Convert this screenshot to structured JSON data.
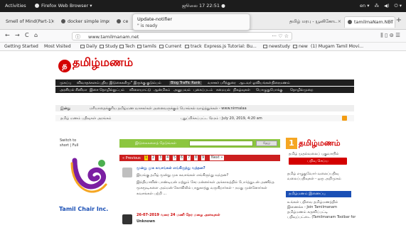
{
  "topbar": {
    "activities": "Activities",
    "app": "Firefox Web Browser ▾",
    "clock": "ஜூலை 17 22:51 ●",
    "lang": "en ▾",
    "net": "⁂",
    "sound": "◀)",
    "power": "⏻ ▾"
  },
  "notification": {
    "title": "Update-notifier",
    "body": "\" is ready"
  },
  "tabs": [
    {
      "label": "Smell of Mind(Part-1)"
    },
    {
      "label": "docker simple imp"
    },
    {
      "label": "ce"
    },
    {
      "label": "தமிழ் மரபு - யூனிகோட"
    },
    {
      "label": "tamilmaNam.NET"
    }
  ],
  "tab_close": "×",
  "tab_new": "+",
  "nav": {
    "back": "←",
    "forward": "→",
    "reload": "C",
    "home": "⌂",
    "url": "www.tamilmanam.net",
    "url_actions": "··· ♡ ☆",
    "tools": "⫼ ▯ ⊚ ☰"
  },
  "bookmarks": [
    "Getting Started",
    "Most Visited",
    "Daily",
    "Study",
    "Tech",
    "tamils",
    "Current",
    "track",
    "Express.js Tutorial: Bu...",
    "newstudy",
    "new",
    "(1) Mugam Tamil Movi..."
  ],
  "site": {
    "logo": "தமிழ்மணம்",
    "menu1": [
      "முகப்பு",
      "விவாதக்களம்",
      "புதிய இடுகைகள்",
      "\"மு\" இருக்கு",
      "குடும்பம்",
      "Blog Traffic Rank",
      "வாசகர் பரிந்துரை",
      "ஆடவர் ஓவியங்கள்",
      "திரைமணம்"
    ],
    "menu2": [
      "அரசியல்",
      "சினிமா",
      "இசை",
      "தொழில்நுட்பம்",
      "விளையாட்டு",
      "ஆன்மிகம்",
      "அனுபவம்",
      "புகைப்படம்",
      "சமையல்",
      "நிகழ்வுகள்",
      "பொழுதுபோக்கு",
      "தொழில்முறை"
    ],
    "ticker_label": "இன்று",
    "ticker_text": "மரியாதைக்குரிய தமிழ்மண வாசகர்கள் அனைவருக்கும் பொங்கல் வாழ்த்துக்கள் - www.nirmalaa",
    "ticker2_left": "தமிழ் மணம் பதிவுகள் அரங்கம்",
    "ticker2_right": "புதுப்பிக்கப்பட்ட நேரம் : July 20, 2019, 4:20 am",
    "switch": "Switch to\nshort | Full",
    "tamil_chair": "Tamil Chair Inc.",
    "search_label": "இடுகைகளைத் தேடுங்கள்",
    "search_button": "தேடு",
    "pager_prev": "« Previous",
    "pager_pages": [
      "1",
      "2",
      "3",
      "4",
      "5",
      "6",
      "7",
      "8",
      "9"
    ],
    "pager_next": "Next »",
    "posts": [
      {
        "title": "மூன்று முக கவசங்கள் எங்கிருந்து வந்தன?",
        "lines": [
          "இயங்கு தமிழ் மூன்று முக கவசங்கள் எங்கிருந்து வந்தன?",
          "இந்தியாவின் பாண்டியன் மற்றும் சேர மன்னர்கள் அக்காலத்தில் போர்த்துடன் அணிந்த",
          "மூகமூடிகளை அம்மன் கோவிலில் பாதுகாத்து வருகிறார்கள் - நமது முன்னோர்கள்",
          "கவசங்கள் பற்றி ..."
        ]
      },
      {
        "title": "26-07-2019 வரை 24 மணி நேர மழை அளவுகள்",
        "lines": [
          "Unknown"
        ],
        "red_title": true
      }
    ],
    "right": {
      "brand": "தமிழ்மணம்",
      "brand_num": "1",
      "sub": "தமிழ் முதல்வலைப் புகுவாயில்",
      "button": "பதிவு செய்ய",
      "blk1": "தமிழ் எழுதுவோர் வலைப்பதிவு\nவலைப்பதிவுகள் - ஒரு அறிமுகம்",
      "head": "தமிழ்மணம் இணைப்பு",
      "blk2": "உங்கள் பதிவை தமிழ்மணத்தில்\nஇணைக்க - Join Tamilmanam\nதமிழ்மணம் கருவிப்பட்டி\nபதிவுப்பட்டை (Tamilmanam Toolbar for"
    }
  }
}
